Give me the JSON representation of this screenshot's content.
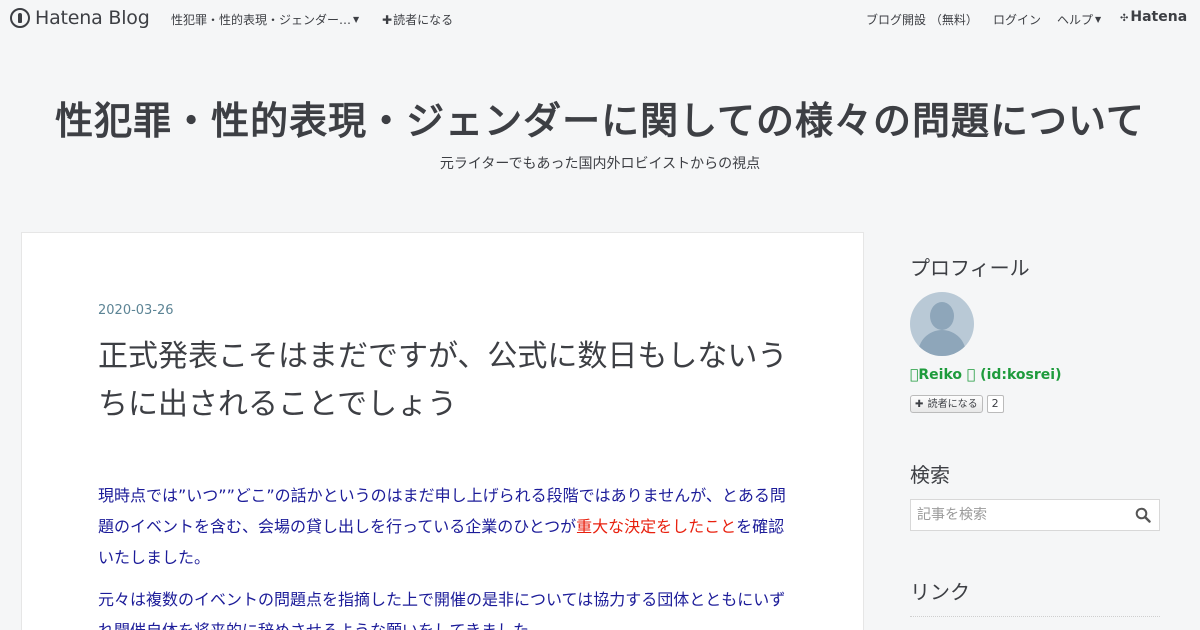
{
  "topbar": {
    "logo_text": "Hatena Blog",
    "blog_dropdown_label": "性犯罪・性的表現・ジェンダー…",
    "subscribe_label": "読者になる",
    "nav": {
      "open_blog": "ブログ開設 （無料）",
      "login": "ログイン",
      "help": "ヘルプ",
      "brand": "Hatena"
    }
  },
  "header": {
    "title": "性犯罪・性的表現・ジェンダーに関しての様々の問題について",
    "description": "元ライターでもあった国内外ロビイストからの視点"
  },
  "entry": {
    "date": "2020-03-26",
    "title": "正式発表こそはまだですが、公式に数日もしないうちに出されることでしょう",
    "paragraph1_part1": "現時点では”いつ””どこ”の話かというのはまだ申し上げられる段階ではありませんが、とある問題のイベントを含む、会場の貸し出しを行っている企業のひとつが",
    "paragraph1_red": "重大な決定をしたこと",
    "paragraph1_part2": "を確認いたしました。",
    "paragraph2": "元々は複数のイベントの問題点を指摘した上で開催の是非については協力する団体とともにいずれ開催自体を将来的に辞めさせるような願いをしてきました。"
  },
  "sidebar": {
    "profile_heading": "プロフィール",
    "profile_name": "Reiko  (id:kosrei)",
    "subscribe_label": "読者になる",
    "subscriber_count": "2",
    "search_heading": "検索",
    "search_placeholder": "記事を検索",
    "link_heading": "リンク"
  },
  "colors": {
    "body_text": "#1c1c99",
    "highlight": "#e8210f",
    "profile_name": "#1e9b3c",
    "date": "#5c8495"
  }
}
